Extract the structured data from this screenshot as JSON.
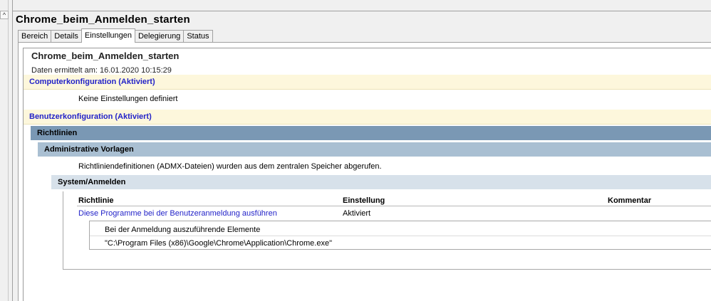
{
  "window": {
    "title": "Chrome_beim_Anmelden_starten",
    "scroll_up_glyph": "^"
  },
  "tabs": [
    {
      "label": "Bereich"
    },
    {
      "label": "Details"
    },
    {
      "label": "Einstellungen",
      "active": true
    },
    {
      "label": "Delegierung"
    },
    {
      "label": "Status"
    }
  ],
  "report": {
    "title": "Chrome_beim_Anmelden_starten",
    "date_text": "Daten ermittelt am: 16.01.2020 10:15:29"
  },
  "computer_config": {
    "header": "Computerkonfiguration (Aktiviert)",
    "empty_text": "Keine Einstellungen definiert"
  },
  "user_config": {
    "header": "Benutzerkonfiguration (Aktiviert)",
    "policies_header": "Richtlinien",
    "admin_templates_header": "Administrative Vorlagen",
    "admx_note": "Richtliniendefinitionen (ADMX-Dateien) wurden aus dem zentralen Speicher abgerufen.",
    "category_header": "System/Anmelden",
    "table": {
      "columns": [
        "Richtlinie",
        "Einstellung",
        "Kommentar"
      ],
      "rows": [
        {
          "policy": "Diese Programme bei der Benutzeranmeldung ausführen",
          "setting": "Aktiviert",
          "comment": ""
        }
      ]
    },
    "detail": {
      "label": "Bei der Anmeldung auszuführende Elemente",
      "value": "\"C:\\Program Files (x86)\\Google\\Chrome\\Application\\Chrome.exe\""
    }
  },
  "colors": {
    "link_blue": "#2323c8",
    "section_yellow": "#fdf7dc",
    "bar_dark": "#7a98b4",
    "bar_mid": "#a9bfd2",
    "bar_light": "#d7e1ea"
  }
}
